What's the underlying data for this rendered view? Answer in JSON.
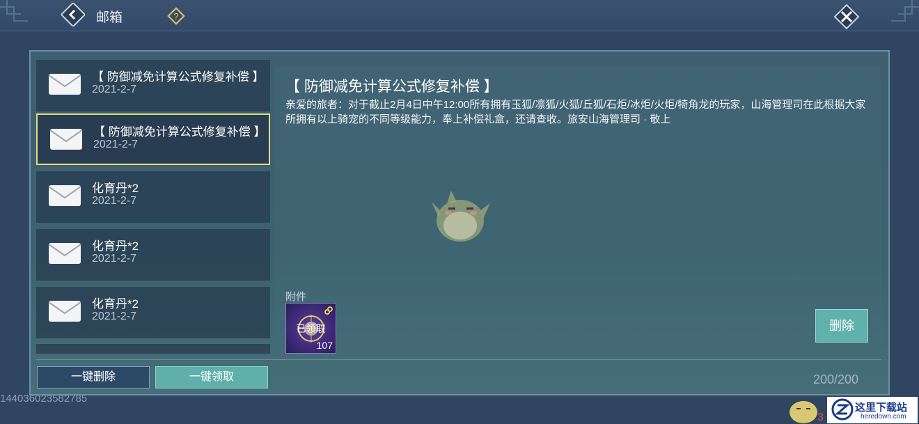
{
  "header": {
    "title": "邮箱",
    "back_icon": "back-arrow-icon",
    "help_icon": "help-icon",
    "close_icon": "close-icon"
  },
  "mail_list": [
    {
      "title": "【 防御减免计算公式修复补偿 】",
      "date": "2021-2-7",
      "selected": false
    },
    {
      "title": "【 防御减免计算公式修复补偿 】",
      "date": "2021-2-7",
      "selected": true
    },
    {
      "title": "化育丹*2",
      "date": "2021-2-7",
      "selected": false
    },
    {
      "title": "化育丹*2",
      "date": "2021-2-7",
      "selected": false
    },
    {
      "title": "化育丹*2",
      "date": "2021-2-7",
      "selected": false
    }
  ],
  "detail": {
    "title": "【 防御减免计算公式修复补偿 】",
    "body": "亲爱的旅者：对于截止2月4日中午12:00所有拥有玉狐/凛狐/火狐/丘狐/石炬/冰炬/火炬/犄角龙的玩家，山海管理司在此根据大家所拥有以上骑宠的不同等级能力，奉上补偿礼盒，还请查收。旅安山海管理司 · 敬上",
    "attachment_label": "附件",
    "attachment": {
      "status": "已领取",
      "count": "107"
    },
    "delete_label": "删除"
  },
  "footer": {
    "delete_all_label": "一键删除",
    "claim_all_label": "一键领取",
    "mail_count": "200/200",
    "uid": "144036023582785"
  },
  "watermark": {
    "name": "这里下载站",
    "url": "heredown.com"
  },
  "colors": {
    "accent": "#5fb2ac",
    "selected_border": "#e6dc7c",
    "background": "#2f4560"
  }
}
